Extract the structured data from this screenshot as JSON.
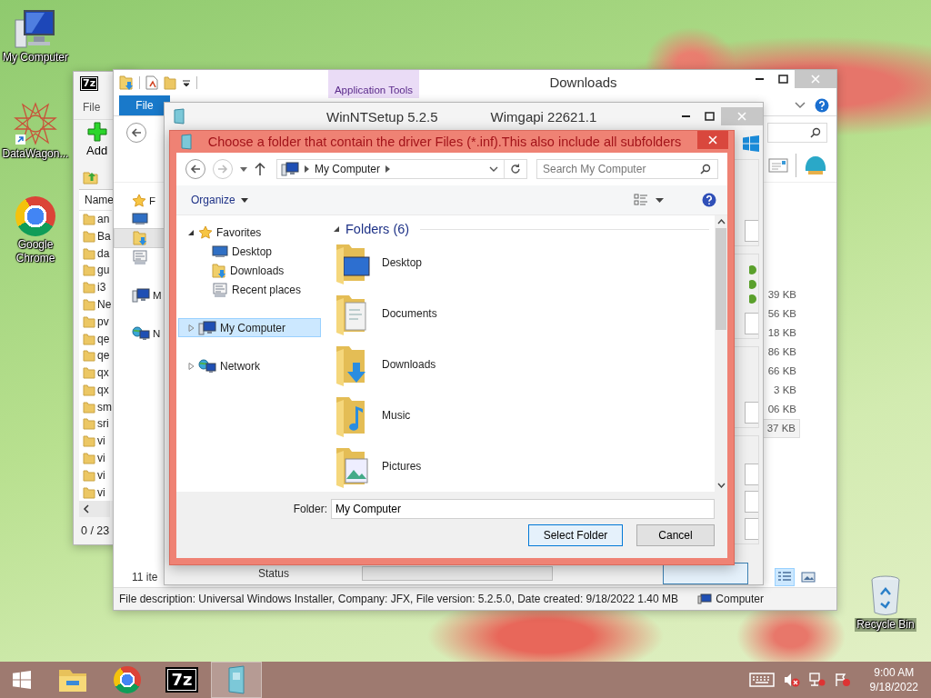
{
  "desktop_icons": [
    {
      "label": "My Computer",
      "kind": "computer"
    },
    {
      "label": "DataWagon...",
      "kind": "web"
    },
    {
      "label": "Google Chrome",
      "kind": "chrome"
    }
  ],
  "recycle_bin": {
    "label": "Recycle Bin"
  },
  "archive_window": {
    "logo": "7z",
    "menu": "File",
    "add_button": "Add",
    "column": "Name",
    "rows": [
      "an",
      "Ba",
      "da",
      "gu",
      "i3",
      "Ne",
      "pv",
      "qe",
      "qe",
      "qx",
      "qx",
      "sm",
      "sri",
      "vi",
      "vi",
      "vi",
      "vi"
    ],
    "status": "0 / 23"
  },
  "explorer_window": {
    "title": "Downloads",
    "context_tab": "Application Tools",
    "file_tab": "File",
    "nav": [
      {
        "kind": "favorites",
        "label": "F",
        "selected": false
      },
      {
        "kind": "desktop",
        "selected": false
      },
      {
        "kind": "downloads",
        "selected": true
      },
      {
        "kind": "recent",
        "selected": false
      },
      {
        "kind": "computer",
        "label": "M",
        "selected": false
      },
      {
        "kind": "network",
        "label": "N",
        "selected": false
      }
    ],
    "sizes": [
      {
        "text": "39 KB",
        "selected": false
      },
      {
        "text": "56 KB",
        "selected": false
      },
      {
        "text": "18 KB",
        "selected": false
      },
      {
        "text": "86 KB",
        "selected": false
      },
      {
        "text": "66 KB",
        "selected": false
      },
      {
        "text": "3 KB",
        "selected": false
      },
      {
        "text": "06 KB",
        "selected": false
      },
      {
        "text": "37 KB",
        "selected": true
      }
    ],
    "item_count": "11 ite",
    "description": "File description: Universal Windows Installer, Company: JFX, File version: 5.2.5.0, Date created: 9/18/2022 1.40 MB",
    "location": "Computer"
  },
  "setup_window": {
    "title": "WinNTSetup 5.2.5",
    "version": "Wimgapi 22621.1",
    "status_label": "Status",
    "progress": {
      "level": 0
    }
  },
  "folder_dialog": {
    "title": "Choose a folder that contain the driver Files (*.inf).This also include all subfolders",
    "path": "My Computer",
    "search_placeholder": "Search My Computer",
    "organize": "Organize",
    "nav": [
      {
        "label": "Favorites",
        "kind": "favorites",
        "expanded": true,
        "selected": false,
        "children": [
          {
            "label": "Desktop",
            "kind": "desktop",
            "selected": false
          },
          {
            "label": "Downloads",
            "kind": "downloads",
            "selected": false
          },
          {
            "label": "Recent places",
            "kind": "recent",
            "selected": false
          }
        ]
      },
      {
        "label": "My Computer",
        "kind": "computer",
        "expanded": false,
        "selected": true
      },
      {
        "label": "Network",
        "kind": "network",
        "expanded": false,
        "selected": false
      }
    ],
    "group": "Folders (6)",
    "folders": [
      {
        "name": "Desktop",
        "kind": "desktop"
      },
      {
        "name": "Documents",
        "kind": "documents"
      },
      {
        "name": "Downloads",
        "kind": "downloads"
      },
      {
        "name": "Music",
        "kind": "music"
      },
      {
        "name": "Pictures",
        "kind": "pictures"
      }
    ],
    "folder_label": "Folder:",
    "folder_value": "My Computer",
    "buttons": [
      {
        "label": "Select Folder",
        "default": true
      },
      {
        "label": "Cancel",
        "default": false
      }
    ]
  },
  "taskbar": {
    "apps": [
      {
        "kind": "explorer",
        "selected": false
      },
      {
        "kind": "chrome",
        "selected": false
      },
      {
        "kind": "archiver",
        "label": "7z",
        "selected": false
      },
      {
        "kind": "setup",
        "selected": true
      }
    ],
    "time": "9:00 AM",
    "date": "9/18/2022"
  }
}
